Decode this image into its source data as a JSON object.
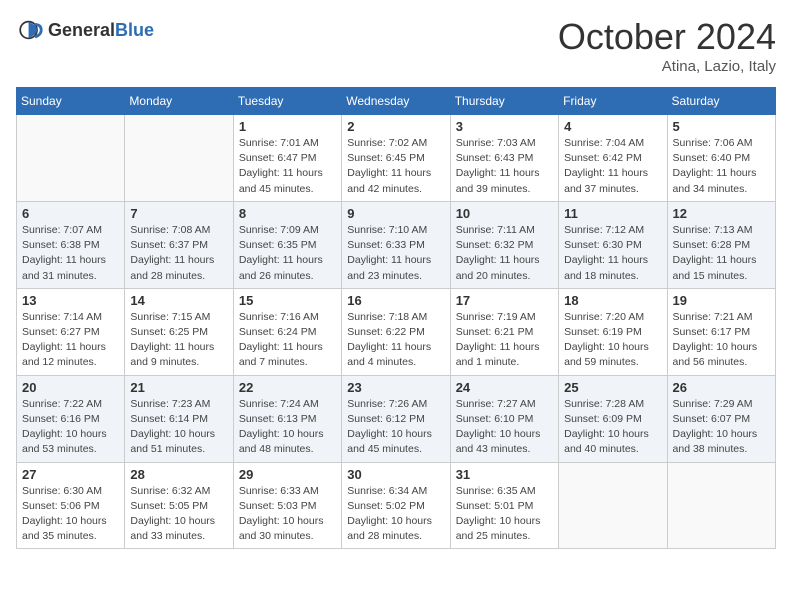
{
  "header": {
    "logo_general": "General",
    "logo_blue": "Blue",
    "title": "October 2024",
    "location": "Atina, Lazio, Italy"
  },
  "weekdays": [
    "Sunday",
    "Monday",
    "Tuesday",
    "Wednesday",
    "Thursday",
    "Friday",
    "Saturday"
  ],
  "weeks": [
    [
      {
        "day": "",
        "sunrise": "",
        "sunset": "",
        "daylight": ""
      },
      {
        "day": "",
        "sunrise": "",
        "sunset": "",
        "daylight": ""
      },
      {
        "day": "1",
        "sunrise": "Sunrise: 7:01 AM",
        "sunset": "Sunset: 6:47 PM",
        "daylight": "Daylight: 11 hours and 45 minutes."
      },
      {
        "day": "2",
        "sunrise": "Sunrise: 7:02 AM",
        "sunset": "Sunset: 6:45 PM",
        "daylight": "Daylight: 11 hours and 42 minutes."
      },
      {
        "day": "3",
        "sunrise": "Sunrise: 7:03 AM",
        "sunset": "Sunset: 6:43 PM",
        "daylight": "Daylight: 11 hours and 39 minutes."
      },
      {
        "day": "4",
        "sunrise": "Sunrise: 7:04 AM",
        "sunset": "Sunset: 6:42 PM",
        "daylight": "Daylight: 11 hours and 37 minutes."
      },
      {
        "day": "5",
        "sunrise": "Sunrise: 7:06 AM",
        "sunset": "Sunset: 6:40 PM",
        "daylight": "Daylight: 11 hours and 34 minutes."
      }
    ],
    [
      {
        "day": "6",
        "sunrise": "Sunrise: 7:07 AM",
        "sunset": "Sunset: 6:38 PM",
        "daylight": "Daylight: 11 hours and 31 minutes."
      },
      {
        "day": "7",
        "sunrise": "Sunrise: 7:08 AM",
        "sunset": "Sunset: 6:37 PM",
        "daylight": "Daylight: 11 hours and 28 minutes."
      },
      {
        "day": "8",
        "sunrise": "Sunrise: 7:09 AM",
        "sunset": "Sunset: 6:35 PM",
        "daylight": "Daylight: 11 hours and 26 minutes."
      },
      {
        "day": "9",
        "sunrise": "Sunrise: 7:10 AM",
        "sunset": "Sunset: 6:33 PM",
        "daylight": "Daylight: 11 hours and 23 minutes."
      },
      {
        "day": "10",
        "sunrise": "Sunrise: 7:11 AM",
        "sunset": "Sunset: 6:32 PM",
        "daylight": "Daylight: 11 hours and 20 minutes."
      },
      {
        "day": "11",
        "sunrise": "Sunrise: 7:12 AM",
        "sunset": "Sunset: 6:30 PM",
        "daylight": "Daylight: 11 hours and 18 minutes."
      },
      {
        "day": "12",
        "sunrise": "Sunrise: 7:13 AM",
        "sunset": "Sunset: 6:28 PM",
        "daylight": "Daylight: 11 hours and 15 minutes."
      }
    ],
    [
      {
        "day": "13",
        "sunrise": "Sunrise: 7:14 AM",
        "sunset": "Sunset: 6:27 PM",
        "daylight": "Daylight: 11 hours and 12 minutes."
      },
      {
        "day": "14",
        "sunrise": "Sunrise: 7:15 AM",
        "sunset": "Sunset: 6:25 PM",
        "daylight": "Daylight: 11 hours and 9 minutes."
      },
      {
        "day": "15",
        "sunrise": "Sunrise: 7:16 AM",
        "sunset": "Sunset: 6:24 PM",
        "daylight": "Daylight: 11 hours and 7 minutes."
      },
      {
        "day": "16",
        "sunrise": "Sunrise: 7:18 AM",
        "sunset": "Sunset: 6:22 PM",
        "daylight": "Daylight: 11 hours and 4 minutes."
      },
      {
        "day": "17",
        "sunrise": "Sunrise: 7:19 AM",
        "sunset": "Sunset: 6:21 PM",
        "daylight": "Daylight: 11 hours and 1 minute."
      },
      {
        "day": "18",
        "sunrise": "Sunrise: 7:20 AM",
        "sunset": "Sunset: 6:19 PM",
        "daylight": "Daylight: 10 hours and 59 minutes."
      },
      {
        "day": "19",
        "sunrise": "Sunrise: 7:21 AM",
        "sunset": "Sunset: 6:17 PM",
        "daylight": "Daylight: 10 hours and 56 minutes."
      }
    ],
    [
      {
        "day": "20",
        "sunrise": "Sunrise: 7:22 AM",
        "sunset": "Sunset: 6:16 PM",
        "daylight": "Daylight: 10 hours and 53 minutes."
      },
      {
        "day": "21",
        "sunrise": "Sunrise: 7:23 AM",
        "sunset": "Sunset: 6:14 PM",
        "daylight": "Daylight: 10 hours and 51 minutes."
      },
      {
        "day": "22",
        "sunrise": "Sunrise: 7:24 AM",
        "sunset": "Sunset: 6:13 PM",
        "daylight": "Daylight: 10 hours and 48 minutes."
      },
      {
        "day": "23",
        "sunrise": "Sunrise: 7:26 AM",
        "sunset": "Sunset: 6:12 PM",
        "daylight": "Daylight: 10 hours and 45 minutes."
      },
      {
        "day": "24",
        "sunrise": "Sunrise: 7:27 AM",
        "sunset": "Sunset: 6:10 PM",
        "daylight": "Daylight: 10 hours and 43 minutes."
      },
      {
        "day": "25",
        "sunrise": "Sunrise: 7:28 AM",
        "sunset": "Sunset: 6:09 PM",
        "daylight": "Daylight: 10 hours and 40 minutes."
      },
      {
        "day": "26",
        "sunrise": "Sunrise: 7:29 AM",
        "sunset": "Sunset: 6:07 PM",
        "daylight": "Daylight: 10 hours and 38 minutes."
      }
    ],
    [
      {
        "day": "27",
        "sunrise": "Sunrise: 6:30 AM",
        "sunset": "Sunset: 5:06 PM",
        "daylight": "Daylight: 10 hours and 35 minutes."
      },
      {
        "day": "28",
        "sunrise": "Sunrise: 6:32 AM",
        "sunset": "Sunset: 5:05 PM",
        "daylight": "Daylight: 10 hours and 33 minutes."
      },
      {
        "day": "29",
        "sunrise": "Sunrise: 6:33 AM",
        "sunset": "Sunset: 5:03 PM",
        "daylight": "Daylight: 10 hours and 30 minutes."
      },
      {
        "day": "30",
        "sunrise": "Sunrise: 6:34 AM",
        "sunset": "Sunset: 5:02 PM",
        "daylight": "Daylight: 10 hours and 28 minutes."
      },
      {
        "day": "31",
        "sunrise": "Sunrise: 6:35 AM",
        "sunset": "Sunset: 5:01 PM",
        "daylight": "Daylight: 10 hours and 25 minutes."
      },
      {
        "day": "",
        "sunrise": "",
        "sunset": "",
        "daylight": ""
      },
      {
        "day": "",
        "sunrise": "",
        "sunset": "",
        "daylight": ""
      }
    ]
  ]
}
